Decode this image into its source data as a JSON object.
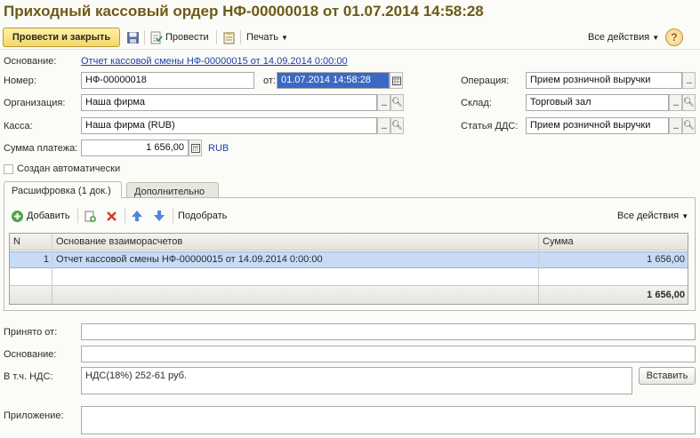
{
  "window": {
    "title": "Приходный кассовый ордер НФ-00000018 от 01.07.2014 14:58:28"
  },
  "toolbar": {
    "post_close_label": "Провести и закрыть",
    "post_label": "Провести",
    "print_label": "Печать",
    "all_actions_label": "Все действия",
    "help_label": "?"
  },
  "form": {
    "basis_label": "Основание:",
    "basis_link": "Отчет кассовой смены НФ-00000015 от 14.09.2014 0:00:00",
    "number_label": "Номер:",
    "number_value": "НФ-00000018",
    "date_label": "от:",
    "date_value": "01.07.2014 14:58:28",
    "operation_label": "Операция:",
    "operation_value": "Прием розничной выручки",
    "org_label": "Организация:",
    "org_value": "Наша фирма",
    "warehouse_label": "Склад:",
    "warehouse_value": "Торговый зал",
    "cash_label": "Касса:",
    "cash_value": "Наша фирма (RUB)",
    "dds_label": "Статья ДДС:",
    "dds_value": "Прием розничной выручки",
    "amount_label": "Сумма платежа:",
    "amount_value": "1 656,00",
    "currency": "RUB",
    "auto_label": "Создан автоматически"
  },
  "tabs": [
    {
      "label": "Расшифровка (1 док.)"
    },
    {
      "label": "Дополнительно"
    }
  ],
  "table_toolbar": {
    "add_label": "Добавить",
    "select_label": "Подобрать",
    "all_actions_label": "Все действия"
  },
  "table": {
    "columns": [
      "N",
      "Основание взаиморасчетов",
      "Сумма"
    ],
    "rows": [
      {
        "n": "1",
        "basis": "Отчет кассовой смены НФ-00000015 от 14.09.2014 0:00:00",
        "sum": "1 656,00"
      }
    ],
    "total": "1 656,00"
  },
  "bottom": {
    "received_label": "Принято от:",
    "received_value": "",
    "basis_label": "Основание:",
    "basis_value": "",
    "vat_label": "В т.ч. НДС:",
    "vat_value": "НДС(18%) 252-61 руб.",
    "insert_label": "Вставить",
    "attachment_label": "Приложение:",
    "attachment_value": ""
  },
  "colors": {
    "title": "#6d5a16",
    "primary_button": "#f4d864",
    "selected_row": "#c7daf6",
    "link": "#1d3fa6"
  }
}
